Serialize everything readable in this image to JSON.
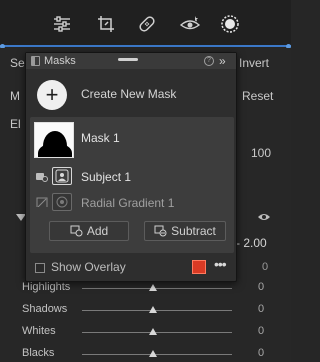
{
  "toolbar": {
    "tools": [
      {
        "name": "edit-sliders-icon"
      },
      {
        "name": "crop-icon"
      },
      {
        "name": "healing-bandage-icon"
      },
      {
        "name": "red-eye-icon"
      },
      {
        "name": "masking-icon"
      }
    ]
  },
  "background": {
    "left_label_top": "Se",
    "right_label_top": "Invert",
    "left_label_2": "M",
    "reset_label": "Reset",
    "left_label_3": "El",
    "amount_value": "100",
    "exposure_value": "- 2.00",
    "sliders": [
      {
        "label": "Highlights",
        "value": "0"
      },
      {
        "label": "Shadows",
        "value": "0"
      },
      {
        "label": "Whites",
        "value": "0"
      },
      {
        "label": "Blacks",
        "value": "0"
      }
    ],
    "side_values": [
      "0",
      "0"
    ]
  },
  "masks_panel": {
    "title": "Masks",
    "help": "?",
    "collapse": "»",
    "create_label": "Create New Mask",
    "create_symbol": "+",
    "masks": [
      {
        "name": "Mask 1"
      }
    ],
    "components": [
      {
        "name": "Subject 1"
      },
      {
        "name": "Radial Gradient 1"
      }
    ],
    "add_label": "Add",
    "subtract_label": "Subtract",
    "show_overlay_label": "Show Overlay",
    "overlay_color": "#d93a24",
    "more": "•••"
  }
}
